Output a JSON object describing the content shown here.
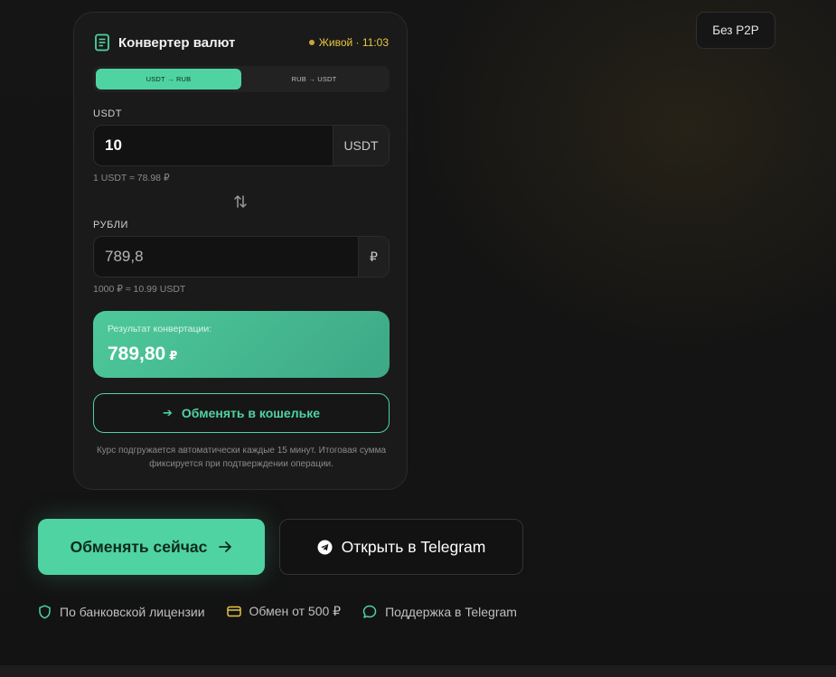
{
  "converter": {
    "title": "Конвертер валют",
    "live_status": "Живой · 11:03",
    "tabs": [
      {
        "label": "USDT → RUB",
        "active": true
      },
      {
        "label": "RUB → USDT",
        "active": false
      }
    ],
    "usdt_field": {
      "label": "USDT",
      "value": "10",
      "unit": "USDT",
      "hint": "1 USDT ≈ 78.98 ₽"
    },
    "rub_field": {
      "label": "РУБЛИ",
      "value": "789,8",
      "unit": "₽",
      "hint": "1000 ₽ ≈ 10.99 USDT"
    },
    "result": {
      "label": "Результат конвертации:",
      "value": "789,80",
      "currency": "₽"
    },
    "wallet_button": {
      "icon": "arrow-right-icon",
      "label": "Обменять в кошельке"
    },
    "note": "Курс подгружается автоматически каждые 15 минут. Итоговая сумма фиксируется при подтверждении операции."
  },
  "badge_no_p2p": "Без P2P",
  "cta": {
    "primary_label": "Обменять сейчас",
    "secondary_label": "Открыть в Telegram"
  },
  "features": [
    {
      "icon": "shield-icon",
      "label": "По банковской лицензии"
    },
    {
      "icon": "card-icon",
      "label": "Обмен от 500 ₽"
    },
    {
      "icon": "chat-bubble-icon",
      "label": "Поддержка в Telegram"
    }
  ],
  "colors": {
    "accent": "#4fd3a2",
    "live": "#e8c640",
    "background": "#141414",
    "card": "#1a1a1a"
  }
}
